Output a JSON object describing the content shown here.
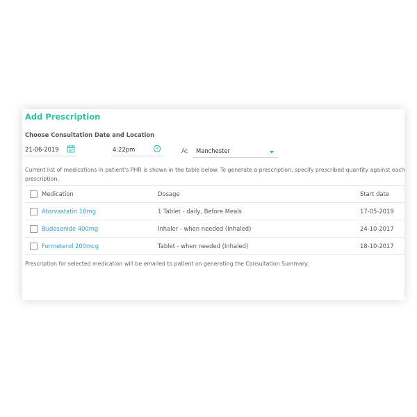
{
  "panel": {
    "title": "Add Prescription",
    "subtitle": "Choose Consultation Date and Location",
    "date_value": "21-06-2019",
    "time_value": "4:22pm",
    "at_label": "At",
    "location_value": "Manchester",
    "info_text": "Current list of medications in patient's PHR is shown in the table below. To generate a prescription, specify prescribed quantity against each prescription.",
    "footer_text": "Prescription for selected medication will be emailed to patient on generating the Consultation Summary."
  },
  "table": {
    "headers": {
      "medication": "Medication",
      "dosage": "Dosage",
      "start_date": "Start date"
    },
    "rows": [
      {
        "medication": "Atorvastatin 10mg",
        "dosage": "1 Tablet - daily, Before Meals",
        "start_date": "17-05-2019",
        "checked": false
      },
      {
        "medication": "Budesonide 400mg",
        "dosage": "Inhaler - when needed (Inhaled)",
        "start_date": "24-10-2017",
        "checked": false
      },
      {
        "medication": "Formeterol 200mcg",
        "dosage": "Tablet - when needed (Inhaled)",
        "start_date": "18-10-2017",
        "checked": false
      }
    ]
  },
  "icons": {
    "date": "calendar-icon",
    "time": "clock-icon",
    "location": "chevron-down-icon"
  },
  "colors": {
    "accent": "#2bc1a6",
    "link": "#2f9fd8",
    "dropdown_caret": "#26a9e0"
  }
}
